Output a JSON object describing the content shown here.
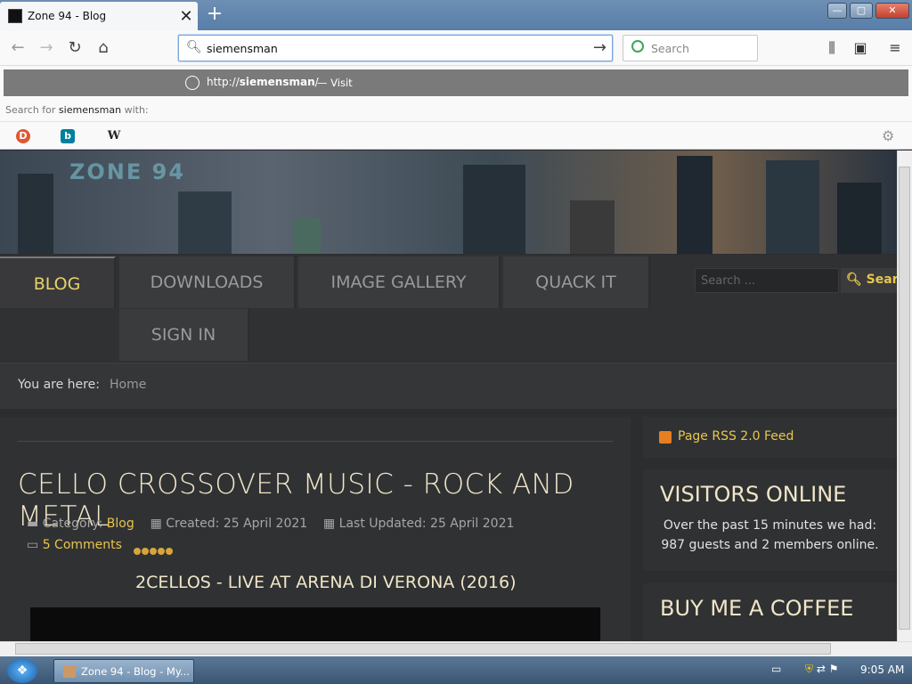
{
  "browser": {
    "tab_title": "Zone 94 - Blog",
    "tab_close": "✕",
    "new_tab": "+",
    "url_value": "siemensman",
    "search_placeholder": "Search",
    "window_buttons": {
      "minimize": "—",
      "maximize": "▢",
      "close": "✕"
    }
  },
  "autocomplete": {
    "url_prefix": "http://",
    "url_bold": "siemensman",
    "url_suffix": "/",
    "visit_label": "— Visit",
    "search_for_prefix": "Search for ",
    "search_for_term": "siemensman",
    "search_for_suffix": " with:",
    "engines": [
      "duckduckgo",
      "bing",
      "wikipedia"
    ]
  },
  "site": {
    "logo_text": "ZONE 94",
    "menu": [
      "BLOG",
      "DOWNLOADS",
      "IMAGE GALLERY",
      "QUACK IT",
      "SIGN IN"
    ],
    "search_placeholder": "Search ...",
    "search_button": "Search",
    "breadcrumb_label": "You are here:",
    "breadcrumb_home": "Home"
  },
  "article": {
    "title": "CELLO CROSSOVER MUSIC - ROCK AND METAL",
    "category_label": "Category:",
    "category": "Blog",
    "created": "Created: 25 April 2021",
    "updated": "Last Updated: 25 April 2021",
    "comments": "5 Comments",
    "rating": 5,
    "subtitle": "2CELLOS - LIVE AT ARENA DI VERONA (2016)"
  },
  "sidebar": {
    "rss": "Page RSS 2.0 Feed",
    "visitors_heading": "VISITORS ONLINE",
    "visitors_text_1": "Over the past 15 minutes we had:",
    "visitors_text_2": "987 guests and 2 members online.",
    "coffee_heading": "BUY ME A COFFEE"
  },
  "taskbar": {
    "start": "❖",
    "task_label": "Zone 94 - Blog - My...",
    "clock": "9:05 AM"
  },
  "colors": {
    "accent": "#e8c64a",
    "heading": "#f0e6c8",
    "bg": "#2c2d2f"
  }
}
